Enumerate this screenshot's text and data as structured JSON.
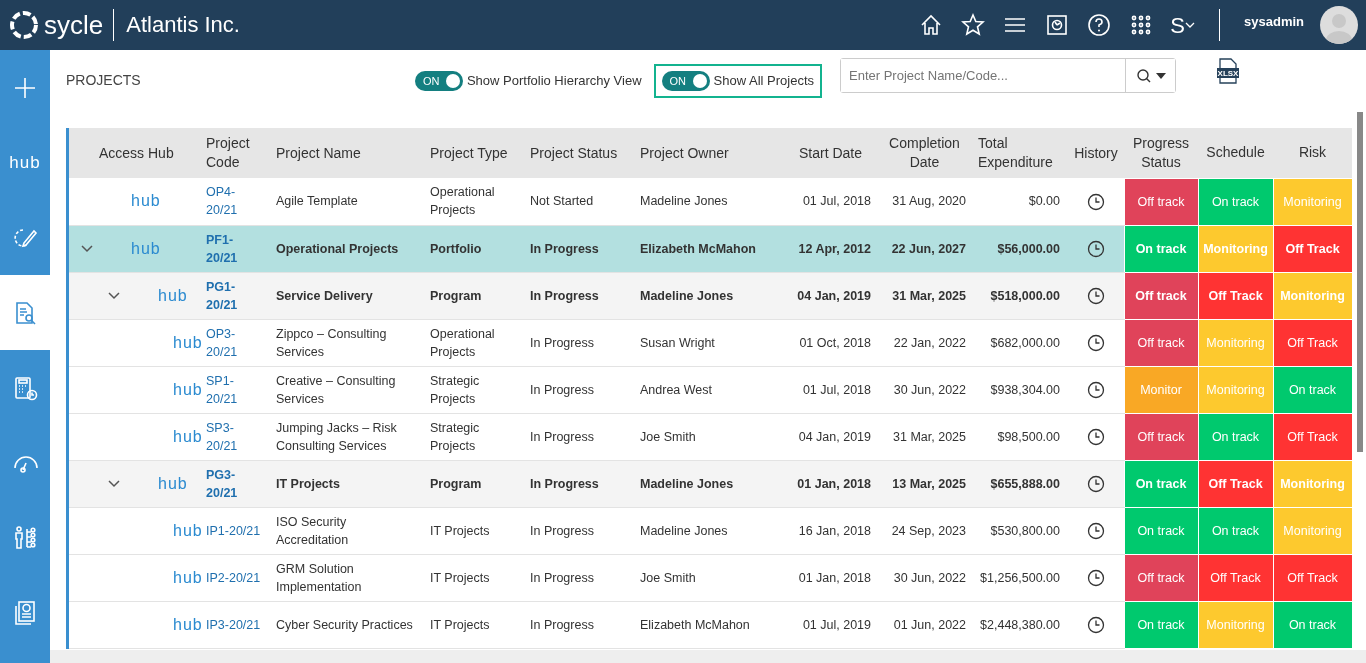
{
  "header": {
    "brand": "sycle",
    "company": "Atlantis Inc.",
    "switcher": "S",
    "user": "sysadmin"
  },
  "sidebar": {
    "items": [
      {
        "kind": "plus",
        "selected": false
      },
      {
        "kind": "hub",
        "label": "hub",
        "selected": false
      },
      {
        "kind": "cycle-edit",
        "selected": false
      },
      {
        "kind": "doc-search",
        "selected": true
      },
      {
        "kind": "calculator",
        "selected": false
      },
      {
        "kind": "gauge",
        "selected": false
      },
      {
        "kind": "people",
        "selected": false
      },
      {
        "kind": "report",
        "selected": false
      }
    ]
  },
  "page": {
    "title": "PROJECTS"
  },
  "toggles": [
    {
      "state": "ON",
      "label": "Show Portfolio Hierarchy View",
      "on": true,
      "focused": false
    },
    {
      "state": "ON",
      "label": "Show All Projects",
      "on": true,
      "focused": true
    }
  ],
  "search": {
    "placeholder": "Enter Project Name/Code..."
  },
  "export": {
    "label": "XLSX"
  },
  "table": {
    "columns": [
      "Access Hub",
      "Project Code",
      "Project Name",
      "Project Type",
      "Project Status",
      "Project Owner",
      "Start Date",
      "Completion Date",
      "Total Expenditure",
      "History",
      "Progress Status",
      "Schedule",
      "Risk"
    ],
    "rows": [
      {
        "kind": "project",
        "hub": "hub",
        "code": "OP4-20/21",
        "name": "Agile Template",
        "type": "Operational Projects",
        "status": "Not Started",
        "owner": "Madeline Jones",
        "start": "01 Jul, 2018",
        "completion": "31 Aug, 2020",
        "expenditure": "$0.00",
        "progress": {
          "text": "Off track",
          "color": "#e0435a"
        },
        "schedule": {
          "text": "On track",
          "color": "#00c96e"
        },
        "risk": {
          "text": "Monitoring",
          "color": "#fdc92e"
        },
        "selected": false
      },
      {
        "kind": "portfolio",
        "hub": "hub",
        "code": "PF1-20/21",
        "name": "Operational Projects",
        "type": "Portfolio",
        "status": "In Progress",
        "owner": "Elizabeth McMahon",
        "start": "12 Apr, 2012",
        "completion": "22 Jun, 2027",
        "expenditure": "$56,000.00",
        "progress": {
          "text": "On track",
          "color": "#00c96e"
        },
        "schedule": {
          "text": "Monitoring",
          "color": "#fdc92e"
        },
        "risk": {
          "text": "Off Track",
          "color": "#ff3333"
        },
        "selected": true,
        "expanded": true,
        "children": [
          {
            "kind": "program",
            "hub": "hub",
            "code": "PG1-20/21",
            "name": "Service Delivery",
            "type": "Program",
            "status": "In Progress",
            "owner": "Madeline Jones",
            "start": "04 Jan, 2019",
            "completion": "31 Mar, 2025",
            "expenditure": "$518,000.00",
            "progress": {
              "text": "Off track",
              "color": "#e0435a"
            },
            "schedule": {
              "text": "Off Track",
              "color": "#ff3333"
            },
            "risk": {
              "text": "Monitoring",
              "color": "#fdc92e"
            },
            "selected": false,
            "expanded": true,
            "children": [
              {
                "kind": "project",
                "hub": "hub",
                "code": "OP3-20/21",
                "name": "Zippco – Consulting Services",
                "type": "Operational Projects",
                "status": "In Progress",
                "owner": "Susan Wright",
                "start": "01 Oct, 2018",
                "completion": "22 Jan, 2022",
                "expenditure": "$682,000.00",
                "progress": {
                  "text": "Off track",
                  "color": "#e0435a"
                },
                "schedule": {
                  "text": "Monitoring",
                  "color": "#fdc92e"
                },
                "risk": {
                  "text": "Off Track",
                  "color": "#ff3333"
                },
                "selected": false
              },
              {
                "kind": "project",
                "hub": "hub",
                "code": "SP1-20/21",
                "name": "Creative – Consulting Services",
                "type": "Strategic Projects",
                "status": "In Progress",
                "owner": "Andrea West",
                "start": "01 Jul, 2018",
                "completion": "30 Jun, 2022",
                "expenditure": "$938,304.00",
                "progress": {
                  "text": "Monitor",
                  "color": "#f9a825"
                },
                "schedule": {
                  "text": "Monitoring",
                  "color": "#fdc92e"
                },
                "risk": {
                  "text": "On track",
                  "color": "#00c96e"
                },
                "selected": false
              },
              {
                "kind": "project",
                "hub": "hub",
                "code": "SP3-20/21",
                "name": "Jumping Jacks – Risk Consulting Services",
                "type": "Strategic Projects",
                "status": "In Progress",
                "owner": "Joe Smith",
                "start": "04 Jan, 2019",
                "completion": "31 Mar, 2025",
                "expenditure": "$98,500.00",
                "progress": {
                  "text": "Off track",
                  "color": "#e0435a"
                },
                "schedule": {
                  "text": "On track",
                  "color": "#00c96e"
                },
                "risk": {
                  "text": "Off Track",
                  "color": "#ff3333"
                },
                "selected": false
              }
            ]
          },
          {
            "kind": "program",
            "hub": "hub",
            "code": "PG3-20/21",
            "name": "IT Projects",
            "type": "Program",
            "status": "In Progress",
            "owner": "Madeline Jones",
            "start": "01 Jan, 2018",
            "completion": "13 Mar, 2025",
            "expenditure": "$655,888.00",
            "progress": {
              "text": "On track",
              "color": "#00c96e"
            },
            "schedule": {
              "text": "Off Track",
              "color": "#ff3333"
            },
            "risk": {
              "text": "Monitoring",
              "color": "#fdc92e"
            },
            "selected": false,
            "expanded": true,
            "children": [
              {
                "kind": "project",
                "hub": "hub",
                "code": "IP1-20/21",
                "name": "ISO Security Accreditation",
                "type": "IT Projects",
                "status": "In Progress",
                "owner": "Madeline Jones",
                "start": "16 Jan, 2018",
                "completion": "24 Sep, 2023",
                "expenditure": "$530,800.00",
                "progress": {
                  "text": "On track",
                  "color": "#00c96e"
                },
                "schedule": {
                  "text": "On track",
                  "color": "#00c96e"
                },
                "risk": {
                  "text": "Monitoring",
                  "color": "#fdc92e"
                },
                "selected": false
              },
              {
                "kind": "project",
                "hub": "hub",
                "code": "IP2-20/21",
                "name": "GRM Solution Implementation",
                "type": "IT Projects",
                "status": "In Progress",
                "owner": "Joe Smith",
                "start": "01 Jan, 2018",
                "completion": "30 Jun, 2022",
                "expenditure": "$1,256,500.00",
                "progress": {
                  "text": "Off track",
                  "color": "#e0435a"
                },
                "schedule": {
                  "text": "Off Track",
                  "color": "#ff3333"
                },
                "risk": {
                  "text": "Off Track",
                  "color": "#ff3333"
                },
                "selected": false
              },
              {
                "kind": "project",
                "hub": "hub",
                "code": "IP3-20/21",
                "name": "Cyber Security Practices",
                "type": "IT Projects",
                "status": "In Progress",
                "owner": "Elizabeth McMahon",
                "start": "01 Jul, 2019",
                "completion": "01 Jun, 2022",
                "expenditure": "$2,448,380.00",
                "progress": {
                  "text": "On track",
                  "color": "#00c96e"
                },
                "schedule": {
                  "text": "Monitoring",
                  "color": "#fdc92e"
                },
                "risk": {
                  "text": "On track",
                  "color": "#00c96e"
                },
                "selected": false
              }
            ]
          }
        ]
      }
    ]
  }
}
